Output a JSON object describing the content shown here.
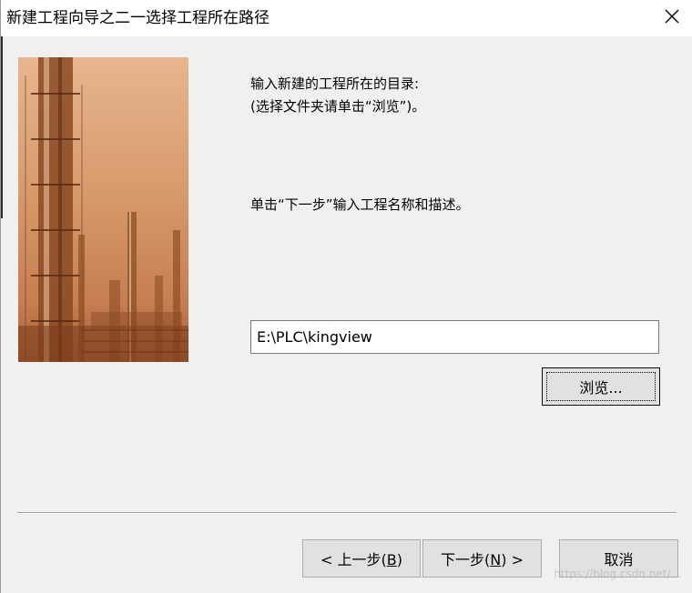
{
  "window": {
    "title": "新建工程向导之二一选择工程所在路径"
  },
  "instructions": {
    "line1": "输入新建的工程所在的目录:",
    "line2": "(选择文件夹请单击“浏览”)。",
    "line3": "单击“下一步”输入工程名称和描述。"
  },
  "path_field": {
    "value": "E:\\PLC\\kingview"
  },
  "buttons": {
    "browse": "浏览...",
    "back_prefix": "< 上一步(",
    "back_key": "B",
    "back_suffix": ")",
    "next_prefix": "下一步(",
    "next_key": "N",
    "next_suffix": ") >",
    "cancel": "取消"
  },
  "watermark": "https://blog.csdn.net/..."
}
